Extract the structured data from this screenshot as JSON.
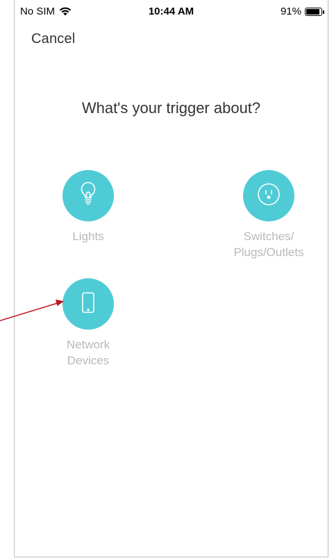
{
  "status_bar": {
    "carrier": "No SIM",
    "time": "10:44 AM",
    "battery_percent": "91%",
    "battery_level": 0.91
  },
  "header": {
    "cancel_label": "Cancel"
  },
  "main": {
    "title": "What's your trigger about?",
    "categories": [
      {
        "line1": "Lights",
        "line2": "",
        "icon": "lightbulb-icon"
      },
      {
        "line1": "Switches/",
        "line2": "Plugs/Outlets",
        "icon": "outlet-icon"
      },
      {
        "line1": "Network",
        "line2": "Devices",
        "icon": "phone-device-icon"
      }
    ]
  },
  "colors": {
    "accent": "#4ecbd5",
    "label": "#b8b8b8",
    "title": "#333333",
    "annotation_arrow": "#c0161c"
  }
}
